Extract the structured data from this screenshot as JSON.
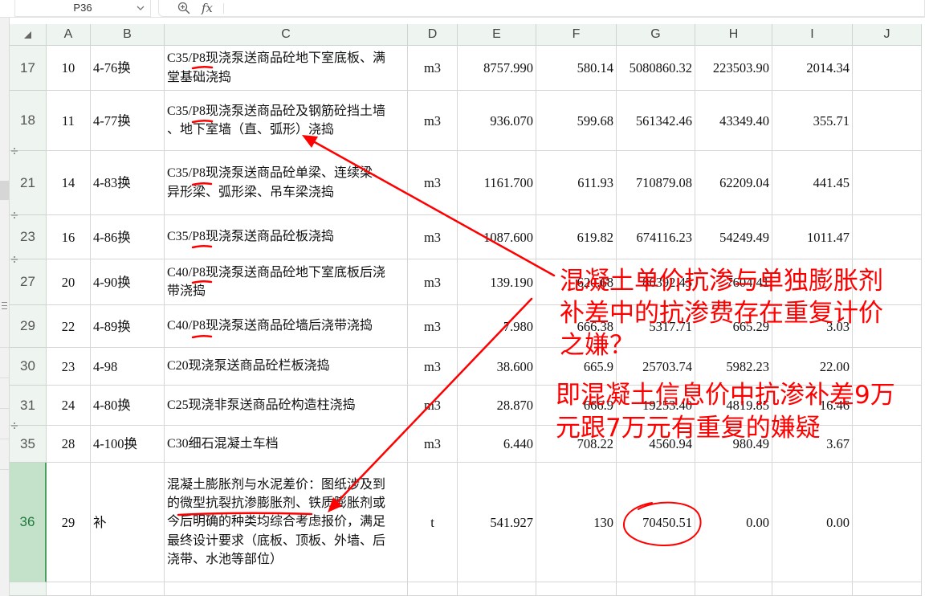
{
  "namebox": {
    "value": "P36",
    "dropdown_icon": "chevron-down-icon"
  },
  "formula_bar": {
    "zoom_icon": "zoom-in-icon",
    "fx_label": "fx",
    "content": ""
  },
  "columns": [
    "A",
    "B",
    "C",
    "D",
    "E",
    "F",
    "G",
    "H",
    "I",
    "J"
  ],
  "rows": [
    {
      "num": "17",
      "cells": {
        "a": "10",
        "b": "4-76换",
        "c": [
          "C35/P8现浇泵送商品砼地下室底板、满",
          "堂基础浇捣"
        ],
        "d": "m3",
        "e": "8757.990",
        "f": "580.14",
        "g": "5080860.32",
        "h": "223503.90",
        "i": "2014.34",
        "j": ""
      }
    },
    {
      "num": "18",
      "cells": {
        "a": "11",
        "b": "4-77换",
        "c": [
          "C35/P8现浇泵送商品砼及钢筋砼挡土墙",
          "、地下室墙（直、弧形）浇捣"
        ],
        "d": "m3",
        "e": "936.070",
        "f": "599.68",
        "g": "561342.46",
        "h": "43349.40",
        "i": "355.71",
        "j": ""
      }
    },
    {
      "num": "21",
      "cells": {
        "a": "14",
        "b": "4-83换",
        "c": [
          "C35/P8现浇泵送商品砼单梁、连续梁、",
          "异形梁、弧形梁、吊车梁浇捣"
        ],
        "d": "m3",
        "e": "1161.700",
        "f": "611.93",
        "g": "710879.08",
        "h": "62209.04",
        "i": "441.45",
        "j": ""
      }
    },
    {
      "num": "23",
      "cells": {
        "a": "16",
        "b": "4-86换",
        "c": [
          "C35/P8现浇泵送商品砼板浇捣"
        ],
        "d": "m3",
        "e": "1087.600",
        "f": "619.82",
        "g": "674116.23",
        "h": "54249.49",
        "i": "1011.47",
        "j": ""
      }
    },
    {
      "num": "27",
      "cells": {
        "a": "20",
        "b": "4-90换",
        "c": [
          "C40/P8现浇泵送商品砼地下室底板后浇",
          "带浇捣"
        ],
        "d": "m3",
        "e": "139.190",
        "f": "620.68",
        "g": "86392.45",
        "h": "7604.41",
        "i": "",
        "j": ""
      }
    },
    {
      "num": "29",
      "cells": {
        "a": "22",
        "b": "4-89换",
        "c": [
          "C40/P8现浇泵送商品砼墙后浇带浇捣"
        ],
        "d": "m3",
        "e": "7.980",
        "f": "666.38",
        "g": "5317.71",
        "h": "665.29",
        "i": "3.03",
        "j": ""
      }
    },
    {
      "num": "30",
      "cells": {
        "a": "23",
        "b": "4-98",
        "c": [
          "C20现浇泵送商品砼栏板浇捣"
        ],
        "d": "m3",
        "e": "38.600",
        "f": "665.9",
        "g": "25703.74",
        "h": "5982.23",
        "i": "22.00",
        "j": ""
      }
    },
    {
      "num": "31",
      "cells": {
        "a": "24",
        "b": "4-80换",
        "c": [
          "C25现浇非泵送商品砼构造柱浇捣"
        ],
        "d": "m3",
        "e": "28.870",
        "f": "666.9",
        "g": "19253.40",
        "h": "4819.85",
        "i": "16.46",
        "j": ""
      }
    },
    {
      "num": "35",
      "cells": {
        "a": "28",
        "b": "4-100换",
        "c": [
          "C30细石混凝土车档"
        ],
        "d": "m3",
        "e": "6.440",
        "f": "708.22",
        "g": "4560.94",
        "h": "980.49",
        "i": "3.67",
        "j": ""
      }
    },
    {
      "num": "36",
      "selected": true,
      "cells": {
        "a": "29",
        "b": "补",
        "c": [
          "混凝土膨胀剂与水泥差价：图纸涉及到",
          "的微型抗裂抗渗膨胀剂、铁质膨胀剂或",
          "今后明确的种类均综合考虑报价，满足",
          "最终设计要求（底板、顶板、外墙、后",
          "浇带、水池等部位）"
        ],
        "d": "t",
        "e": "541.927",
        "f": "130",
        "g": "70450.51",
        "h": "0.00",
        "i": "0.00",
        "j": ""
      }
    },
    {
      "num": "",
      "cells": {}
    }
  ],
  "annotations": {
    "note_1": [
      "混凝土单价抗渗与单独膨胀剂",
      "补差中的抗渗费存在重复计价",
      "之嫌？"
    ],
    "note_2": [
      "即混凝土信息价中抗渗补差9万",
      "元跟7万元有重复的嫌疑"
    ]
  },
  "colors": {
    "grid": "#d6d6d6",
    "header-bg": "#eef4ef",
    "selected-bg": "#c4e2ca",
    "selected-text": "#1f7a3d",
    "annotation": "#ff0000"
  }
}
